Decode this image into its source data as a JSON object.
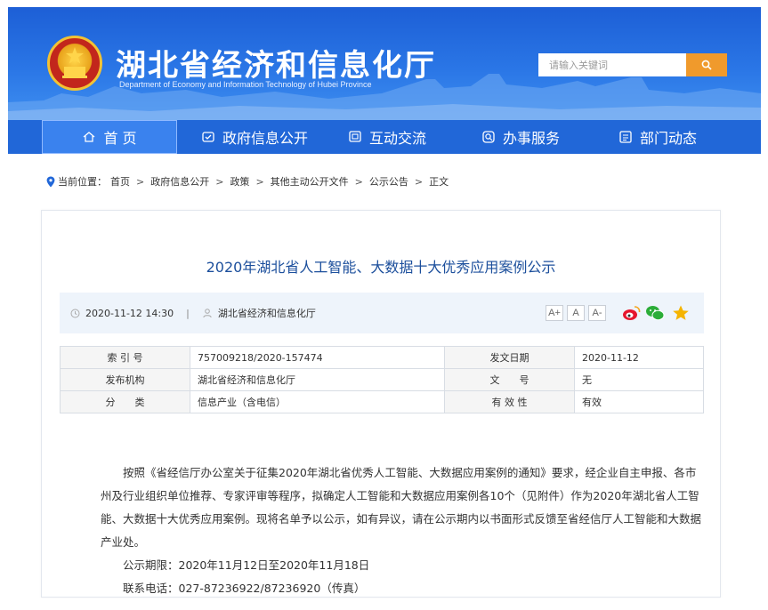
{
  "header": {
    "title": "湖北省经济和信息化厅",
    "subtitle": "Department of Economy and Information Technology of Hubei Province",
    "search": {
      "placeholder": "请输入关键词"
    }
  },
  "nav": {
    "items": [
      {
        "label": "首 页",
        "icon": "home-icon",
        "active": true
      },
      {
        "label": "政府信息公开",
        "icon": "document-icon",
        "active": false
      },
      {
        "label": "互动交流",
        "icon": "chat-icon",
        "active": false
      },
      {
        "label": "办事服务",
        "icon": "service-icon",
        "active": false
      },
      {
        "label": "部门动态",
        "icon": "news-icon",
        "active": false
      }
    ]
  },
  "breadcrumb": {
    "prefix": "当前位置：",
    "items": [
      "首页",
      "政府信息公开",
      "政策",
      "其他主动公开文件",
      "公示公告",
      "正文"
    ],
    "separator": ">"
  },
  "article": {
    "title": "2020年湖北省人工智能、大数据十大优秀应用案例公示",
    "date": "2020-11-12 14:30",
    "divider": "|",
    "source": "湖北省经济和信息化厅",
    "font_buttons": [
      "A+",
      "A",
      "A-"
    ],
    "share": [
      "weibo-icon",
      "wechat-icon",
      "favorite-icon"
    ],
    "info": {
      "index_label": "索 引 号",
      "index_value": "757009218/2020-157474",
      "date_label": "发文日期",
      "date_value": "2020-11-12",
      "org_label": "发布机构",
      "org_value": "湖北省经济和信息化厅",
      "docno_label": "文　　号",
      "docno_value": "无",
      "category_label": "分　　类",
      "category_value": "信息产业（含电信）",
      "validity_label": "有 效 性",
      "validity_value": "有效"
    },
    "body": {
      "paragraph": "按照《省经信厅办公室关于征集2020年湖北省优秀人工智能、大数据应用案例的通知》要求，经企业自主申报、各市州及行业组织单位推荐、专家评审等程序，拟确定人工智能和大数据应用案例各10个（见附件）作为2020年湖北省人工智能、大数据十大优秀应用案例。现将名单予以公示，如有异议，请在公示期内以书面形式反馈至省经信厅人工智能和大数据产业处。",
      "period": "公示期限：2020年11月12日至2020年11月18日",
      "phone": "联系电话：027-87236922/87236920（传真）"
    }
  },
  "colors": {
    "banner": "#2a76e6",
    "nav": "#2167d8",
    "search_button": "#f09a2c",
    "title": "#1c4f9c"
  }
}
